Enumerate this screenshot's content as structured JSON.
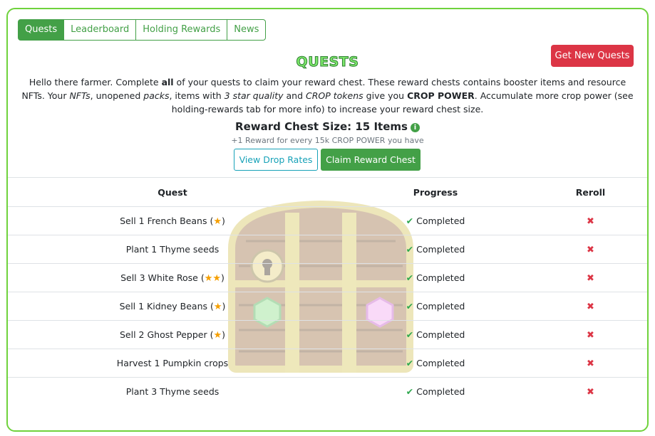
{
  "tabs": [
    "Quests",
    "Leaderboard",
    "Holding Rewards",
    "News"
  ],
  "active_tab": "Quests",
  "header": {
    "title": "QUESTS",
    "new_quests_button": "Get New Quests"
  },
  "intro": {
    "p1": "Hello there farmer. Complete ",
    "b1": "all",
    "p2": " of your quests to claim your reward chest. These reward chests contains booster items and resource NFTs. Your ",
    "i1": "NFTs",
    "p3": ", unopened ",
    "i2": "packs",
    "p4": ", items with ",
    "i3": "3 star quality",
    "p5": " and ",
    "i4": "CROP tokens",
    "p6": " give you ",
    "b2": "CROP POWER",
    "p7": ". Accumulate more crop power (see holding-rewards tab for more info) to increase your reward chest size."
  },
  "reward": {
    "chest_size": "Reward Chest Size: 15 Items",
    "info_icon": "i",
    "note": "+1 Reward for every 15k CROP POWER you have",
    "view_drop_rates": "View Drop Rates",
    "claim_button": "Claim Reward Chest"
  },
  "table": {
    "headers": {
      "quest": "Quest",
      "progress": "Progress",
      "reroll": "Reroll"
    },
    "rows": [
      {
        "name": "Sell 1 French Beans (",
        "stars": "★",
        "close": ")",
        "progress": "Completed"
      },
      {
        "name": "Plant 1 Thyme seeds",
        "stars": "",
        "close": "",
        "progress": "Completed"
      },
      {
        "name": "Sell 3 White Rose (",
        "stars": "★★",
        "close": ")",
        "progress": "Completed"
      },
      {
        "name": "Sell 1 Kidney Beans (",
        "stars": "★",
        "close": ")",
        "progress": "Completed"
      },
      {
        "name": "Sell 2 Ghost Pepper (",
        "stars": "★",
        "close": ")",
        "progress": "Completed"
      },
      {
        "name": "Harvest 1 Pumpkin crops",
        "stars": "",
        "close": "",
        "progress": "Completed"
      },
      {
        "name": "Plant 3 Thyme seeds",
        "stars": "",
        "close": "",
        "progress": "Completed"
      }
    ],
    "check_glyph": "✔",
    "reroll_glyph": "✖"
  },
  "colors": {
    "accent": "#43a047",
    "danger": "#dc3545",
    "info": "#17a2b8",
    "border": "#6fd23c"
  },
  "icons": [
    "info-icon",
    "check-icon",
    "star-icon",
    "close-icon",
    "treasure-chest-icon"
  ]
}
